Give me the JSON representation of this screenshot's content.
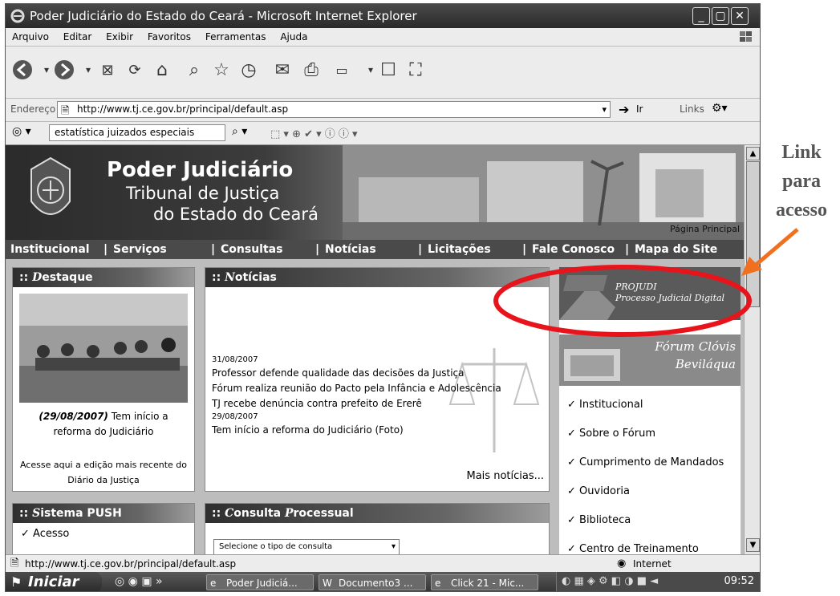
{
  "window": {
    "title": "Poder Judiciário do Estado do Ceará - Microsoft Internet Explorer"
  },
  "menu": [
    "Arquivo",
    "Editar",
    "Exibir",
    "Favoritos",
    "Ferramentas",
    "Ajuda"
  ],
  "address": {
    "label": "Endereço",
    "url": "http://www.tj.ce.gov.br/principal/default.asp",
    "go": "Ir",
    "links": "Links"
  },
  "search": {
    "value": "estatística juizados especiais"
  },
  "banner": {
    "line1": "Poder Judiciário",
    "line2": "Tribunal de Justiça",
    "line3": "do Estado do Ceará",
    "home": "Página Principal"
  },
  "nav": [
    "Institucional",
    "Serviços",
    "Consultas",
    "Notícias",
    "Licitações",
    "Fale Conosco",
    "Mapa do Site"
  ],
  "destaque": {
    "title_cap": "D",
    "title_rest": "estaque",
    "caption_date": "(29/08/2007)",
    "caption_text": " Tem início a reforma do Judiciário",
    "diario": "Acesse aqui a edição mais recente do Diário da Justiça"
  },
  "noticias": {
    "title_cap": "N",
    "title_rest": "otícias",
    "groups": [
      {
        "date": "31/08/2007",
        "items": [
          "Professor defende qualidade das decisões da Justiça",
          "Fórum realiza reunião do Pacto pela Infância e Adolescência",
          "TJ recebe denúncia contra prefeito de Ererê"
        ]
      },
      {
        "date": "29/08/2007",
        "items": [
          "Tem início a reforma do Judiciário (Foto)"
        ]
      }
    ],
    "more": "Mais notícias..."
  },
  "push": {
    "title_cap": "S",
    "title_rest": "istema PUSH",
    "item": "Acesso"
  },
  "consulta": {
    "title_cap1": "C",
    "title_rest1": "onsulta ",
    "title_cap2": "P",
    "title_rest2": "rocessual",
    "select": "Selecione o tipo de consulta"
  },
  "projudi": {
    "line1": "PROJUDI",
    "line2": "Processo Judicial Digital"
  },
  "forum": {
    "line1": "Fórum Clóvis",
    "line2": "Beviláqua"
  },
  "sidelinks": [
    "Institucional",
    "Sobre o Fórum",
    "Cumprimento de Mandados",
    "Ouvidoria",
    "Biblioteca",
    "Centro de Treinamento"
  ],
  "status": {
    "url": "http://www.tj.ce.gov.br/principal/default.asp",
    "zone": "Internet"
  },
  "taskbar": {
    "start": "Iniciar",
    "tasks": [
      "Poder Judiciá...",
      "Documento3 ...",
      "Click 21 - Mic..."
    ],
    "clock": "09:52"
  },
  "annotation": {
    "lines": [
      "Link",
      "para",
      "acesso"
    ]
  },
  "colors": {
    "highlight_ellipse": "#e8141b",
    "arrow": "#f07020",
    "annotation_text": "#555555"
  }
}
